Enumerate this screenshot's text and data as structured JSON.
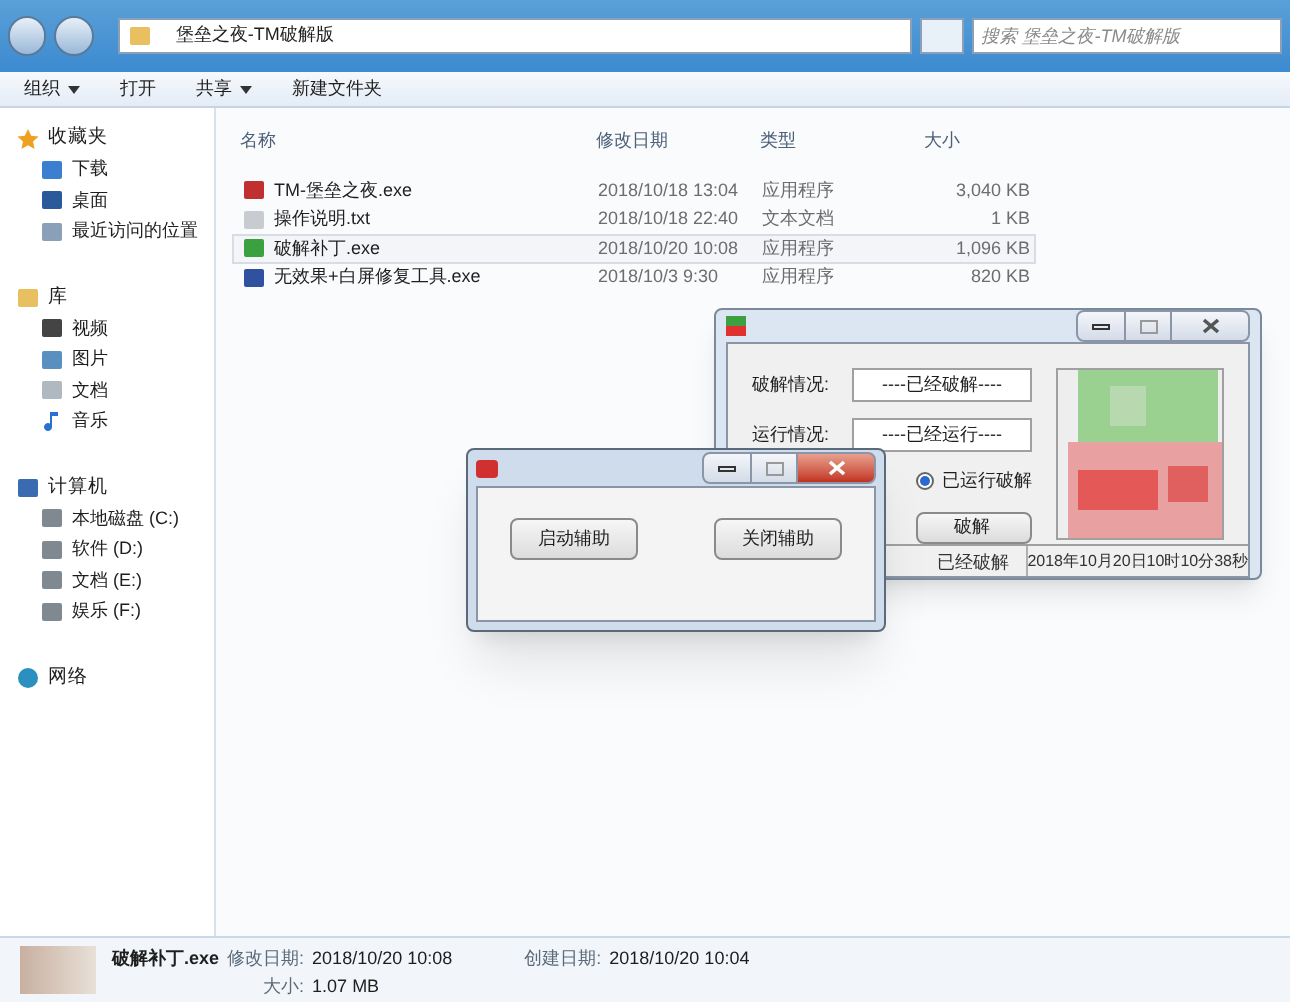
{
  "explorer": {
    "path": "堡垒之夜-TM破解版",
    "search": {
      "placeholder": "搜索 堡垒之夜-TM破解版"
    },
    "toolbar": [
      {
        "label": "组织",
        "dropdown": true
      },
      {
        "label": "打开",
        "dropdown": false
      },
      {
        "label": "共享",
        "dropdown": true
      },
      {
        "label": "新建文件夹",
        "dropdown": false
      }
    ],
    "sidebar": [
      {
        "label": "收藏夹",
        "kind": "star",
        "children": [
          {
            "label": "下载",
            "kind": "download"
          },
          {
            "label": "桌面",
            "kind": "desktop"
          },
          {
            "label": "最近访问的位置",
            "kind": "recent"
          }
        ]
      },
      {
        "label": "库",
        "kind": "folder",
        "children": [
          {
            "label": "视频",
            "kind": "video"
          },
          {
            "label": "图片"
          },
          {
            "label": "文档",
            "kind": "doc"
          },
          {
            "label": "音乐",
            "kind": "music"
          }
        ]
      },
      {
        "label": "计算机",
        "kind": "computer",
        "children": [
          {
            "label": "本地磁盘 (C:)",
            "kind": "disk"
          },
          {
            "label": "软件 (D:)",
            "kind": "disk"
          },
          {
            "label": "文档 (E:)",
            "kind": "disk"
          },
          {
            "label": "娱乐 (F:)",
            "kind": "disk"
          }
        ]
      },
      {
        "label": "网络",
        "kind": "network"
      }
    ],
    "columns": [
      "名称",
      "修改日期",
      "类型",
      "大小"
    ],
    "files": [
      {
        "name": "TM-堡垒之夜.exe",
        "date": "2018/10/18 13:04",
        "type": "应用程序",
        "size": "3,040 KB",
        "kind": "app",
        "selected": false
      },
      {
        "name": "操作说明.txt",
        "date": "2018/10/18 22:40",
        "type": "文本文档",
        "size": "1 KB",
        "kind": "txt",
        "selected": false
      },
      {
        "name": "破解补丁.exe",
        "date": "2018/10/20 10:08",
        "type": "应用程序",
        "size": "1,096 KB",
        "kind": "patch",
        "selected": true
      },
      {
        "name": "无效果+白屏修复工具.exe",
        "date": "2018/10/3 9:30",
        "type": "应用程序",
        "size": "820 KB",
        "kind": "tool",
        "selected": false
      }
    ],
    "details": {
      "name": "破解补丁.exe",
      "modified_label": "修改日期:",
      "modified": "2018/10/20 10:08",
      "created_label": "创建日期:",
      "created": "2018/10/20 10:04",
      "size_label": "大小:",
      "size": "1.07 MB"
    }
  },
  "patch_window": {
    "crack_label": "破解情况:",
    "crack_value": "----已经破解----",
    "run_label": "运行情况:",
    "run_value": "----已经运行----",
    "radio": {
      "label": "已运行破解",
      "selected": true
    },
    "button": "破解",
    "status": [
      "已经破解",
      "2018年10月20日10时10分38秒"
    ]
  },
  "helper_window": {
    "buttons": [
      "启动辅助",
      "关闭辅助"
    ]
  }
}
